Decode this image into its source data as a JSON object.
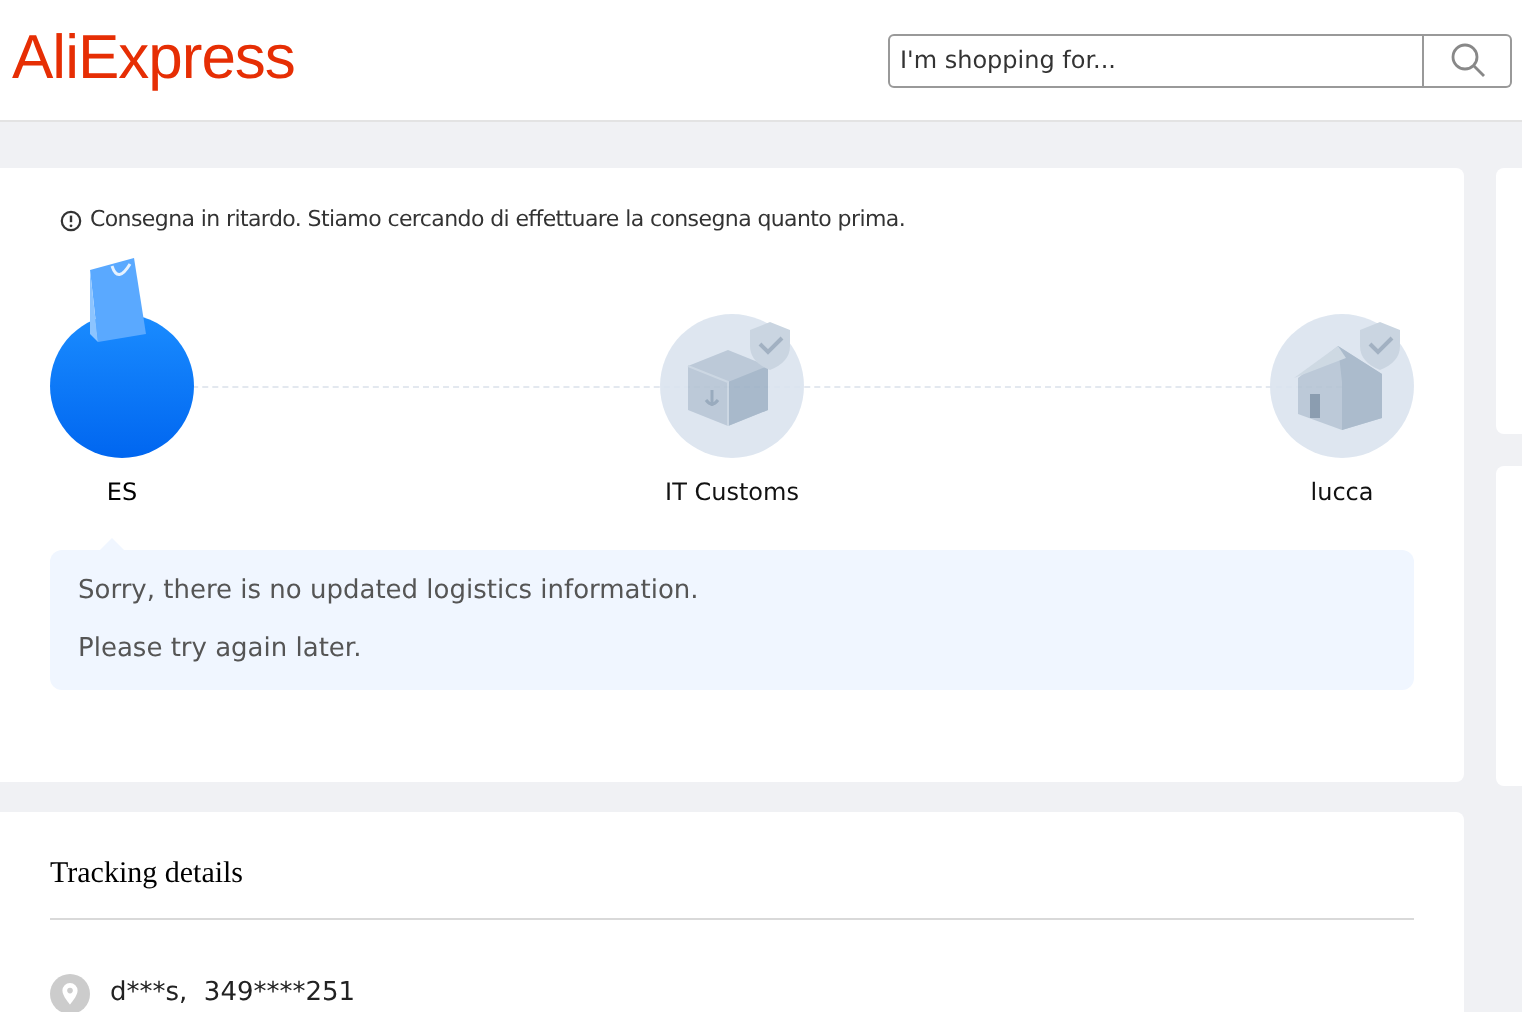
{
  "header": {
    "logo": "AliExpress",
    "search": {
      "placeholder": "I'm shopping for..."
    }
  },
  "notice": "Consegna in ritardo. Stiamo cercando di effettuare la consegna quanto prima.",
  "steps": [
    {
      "label": "ES",
      "kind": "bag",
      "active": true
    },
    {
      "label": "IT Customs",
      "kind": "customs",
      "active": false
    },
    {
      "label": "lucca",
      "kind": "house",
      "active": false
    }
  ],
  "message": [
    "Sorry, there is no updated logistics information.",
    "Please try again later."
  ],
  "tracking": {
    "title": "Tracking details",
    "contact": "d***s,  349****251"
  }
}
